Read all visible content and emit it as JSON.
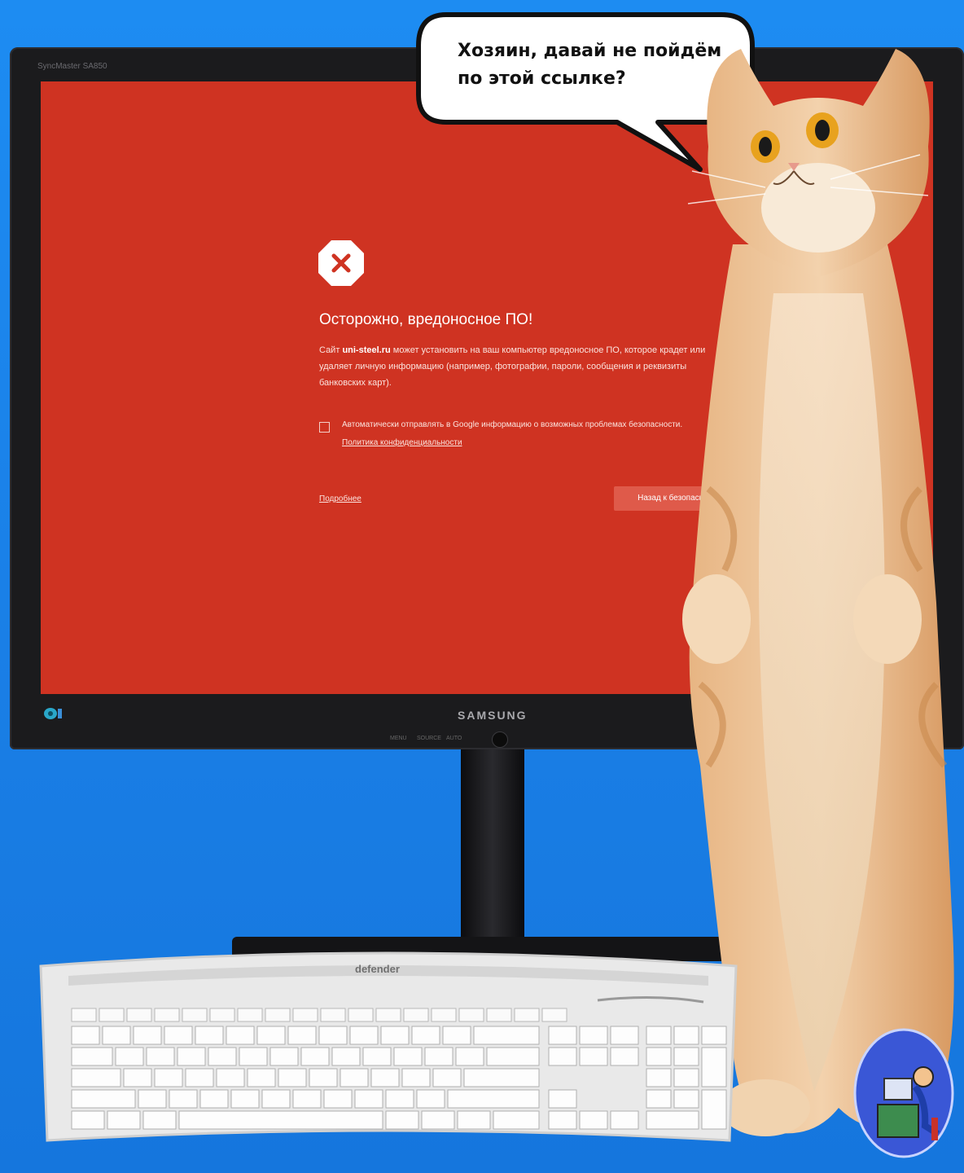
{
  "monitor": {
    "model_label": "SyncMaster SA850",
    "brand": "SAMSUNG",
    "controls": [
      "MENU",
      "SOURCE",
      "AUTO",
      "",
      "",
      "",
      ""
    ]
  },
  "warning_page": {
    "title": "Осторожно, вредоносное ПО!",
    "body_prefix": "Сайт ",
    "site": "uni-steel.ru",
    "body_suffix": " может установить на ваш компьютер вредоносное ПО, которое крадет или удаляет личную информацию (например, фотографии, пароли, сообщения и реквизиты банковских карт).",
    "report_checkbox_label": "Автоматически отправлять в Google информацию о возможных проблемах безопасности.",
    "report_checked": false,
    "privacy_link": "Политика конфиденциальности",
    "details_link": "Подробнее",
    "back_button": "Назад к безопасности",
    "accent_color": "#cf3322"
  },
  "bubble": {
    "text": "Хозяин, давай не пойдём по этой ссылке?"
  },
  "keyboard": {
    "brand": "defender"
  },
  "icons": {
    "warning": "stop-x-icon",
    "cat": "cat-illustration",
    "logo": "pc-user-logo"
  }
}
